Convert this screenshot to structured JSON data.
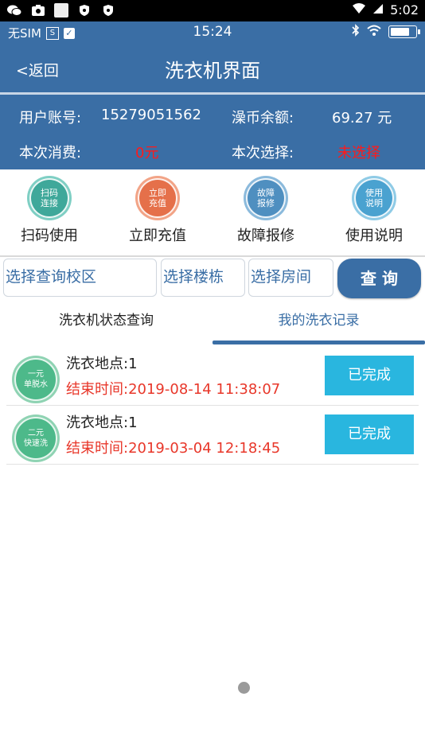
{
  "system_status": {
    "time": "5:02"
  },
  "app_status": {
    "carrier": "无SIM",
    "sim_icon_text": "S",
    "time": "15:24",
    "battery_level": 0.9
  },
  "header": {
    "back_label": "<返回",
    "title": "洗衣机界面"
  },
  "account": {
    "user_label": "用户账号:",
    "user_value": "15279051562",
    "balance_label": "澡币余额:",
    "balance_value": "69.27 元",
    "spend_label": "本次消费:",
    "spend_value": "0元",
    "choice_label": "本次选择:",
    "choice_value": "未选择"
  },
  "actions": [
    {
      "icon_text": "扫码\n连接",
      "caption": "扫码使用",
      "color": "#3fa89a",
      "ring": "#7fcfc4"
    },
    {
      "icon_text": "立即\n充值",
      "caption": "立即充值",
      "color": "#e5704a",
      "ring": "#f2a487"
    },
    {
      "icon_text": "故障\n报修",
      "caption": "故障报修",
      "color": "#4f8fc0",
      "ring": "#8bbadc"
    },
    {
      "icon_text": "使用\n说明",
      "caption": "使用说明",
      "color": "#4aa2d0",
      "ring": "#8fcbe6"
    }
  ],
  "search": {
    "campus_placeholder": "选择查询校区",
    "building_placeholder": "选择楼栋",
    "room_placeholder": "选择房间",
    "query_label": "查 询"
  },
  "tabs": {
    "status_tab": "洗衣机状态查询",
    "records_tab": "我的洗衣记录"
  },
  "records": [
    {
      "badge": "一元\n单脱水",
      "location": "洗衣地点:1",
      "end_time": "结束时间:2019-08-14 11:38:07",
      "status": "已完成"
    },
    {
      "badge": "二元\n快速洗",
      "location": "洗衣地点:1",
      "end_time": "结束时间:2019-03-04 12:18:45",
      "status": "已完成"
    }
  ],
  "colors": {
    "primary": "#3a6ea5",
    "danger": "#ff1a1a",
    "done_button": "#29b6df",
    "badge_green": "#4db98a"
  }
}
